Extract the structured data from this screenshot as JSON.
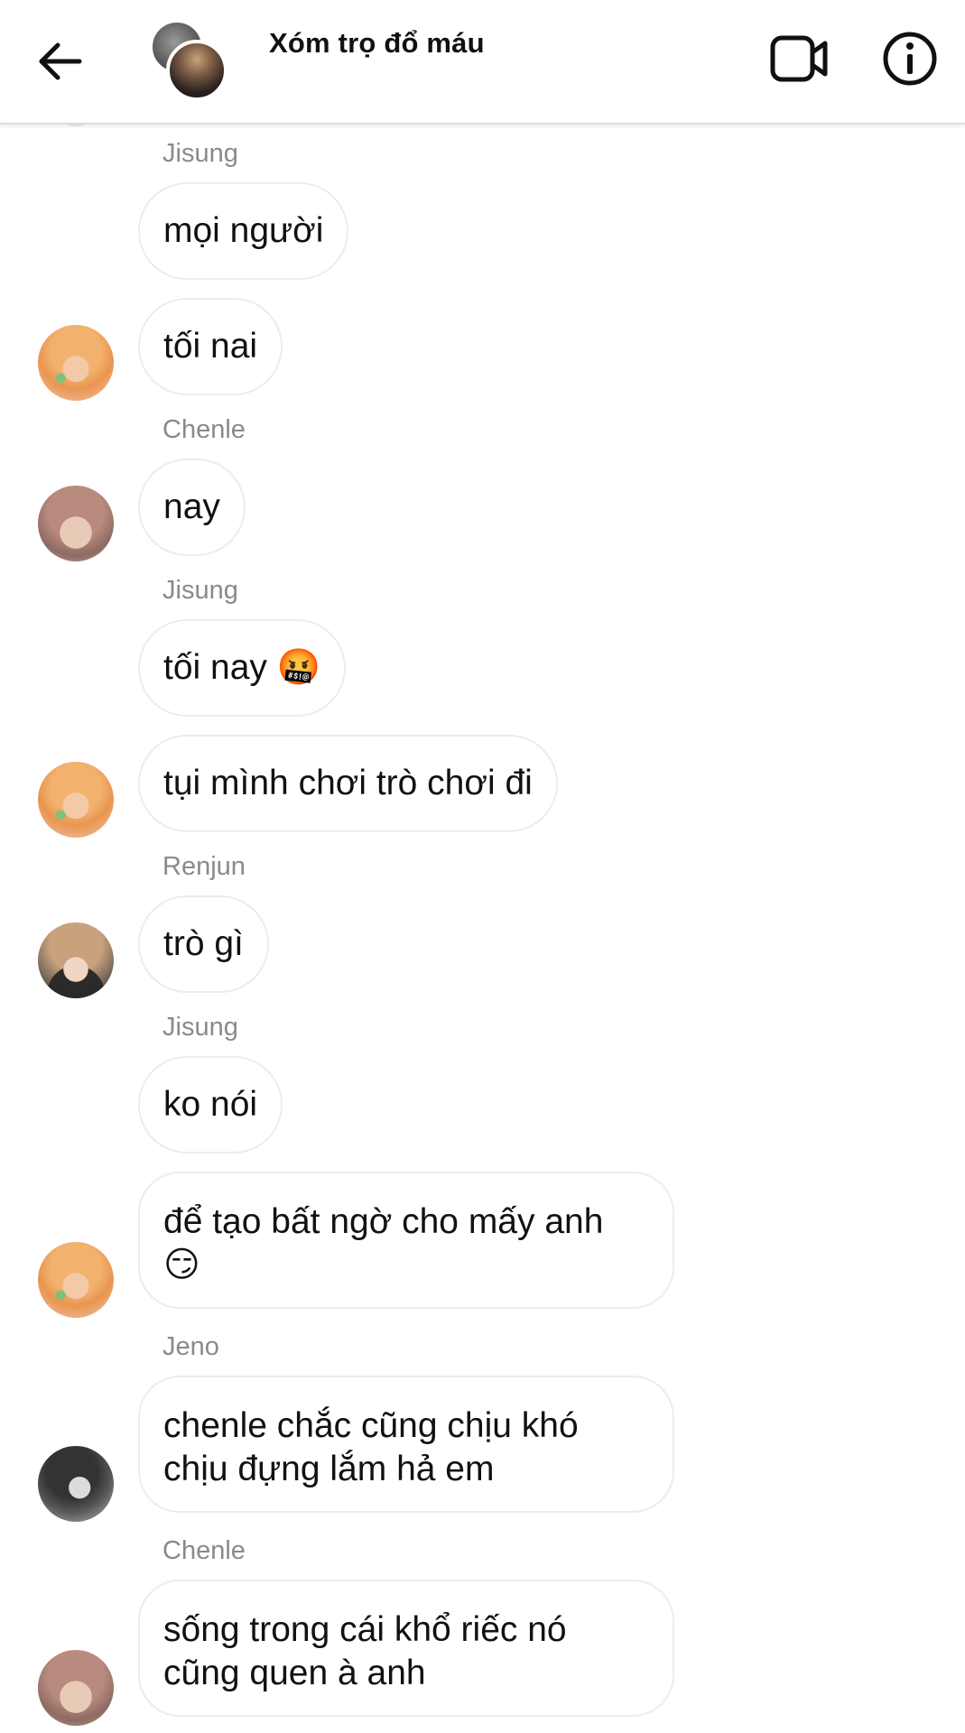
{
  "header": {
    "title": "Xóm trọ đổ máu",
    "back_icon": "arrow-left-icon",
    "video_icon": "video-camera-icon",
    "info_icon": "info-icon"
  },
  "messages": [
    {
      "sender": "Jisung",
      "text": "mọi người"
    },
    {
      "sender": "Jisung",
      "text": "tối nai"
    },
    {
      "sender": "Chenle",
      "text": "nay"
    },
    {
      "sender": "Jisung",
      "text": "tối nay 🤬"
    },
    {
      "sender": "Jisung",
      "text": "tụi mình chơi trò chơi đi"
    },
    {
      "sender": "Renjun",
      "text": "trò gì"
    },
    {
      "sender": "Jisung",
      "text": "ko nói"
    },
    {
      "sender": "Jisung",
      "text": "để tạo bất ngờ cho mấy anh\n😏"
    },
    {
      "sender": "Jeno",
      "text": "chenle chắc cũng chịu khó\nchịu đựng lắm hả em"
    },
    {
      "sender": "Chenle",
      "text": "sống trong cái khổ riếc nó\ncũng quen à anh"
    }
  ],
  "colors": {
    "bubble_border": "#ececec",
    "sender_name": "#8a8a8a",
    "text": "#111111",
    "cursing_emoji": "#e0401f",
    "smirk_emoji": "#f7c331"
  }
}
